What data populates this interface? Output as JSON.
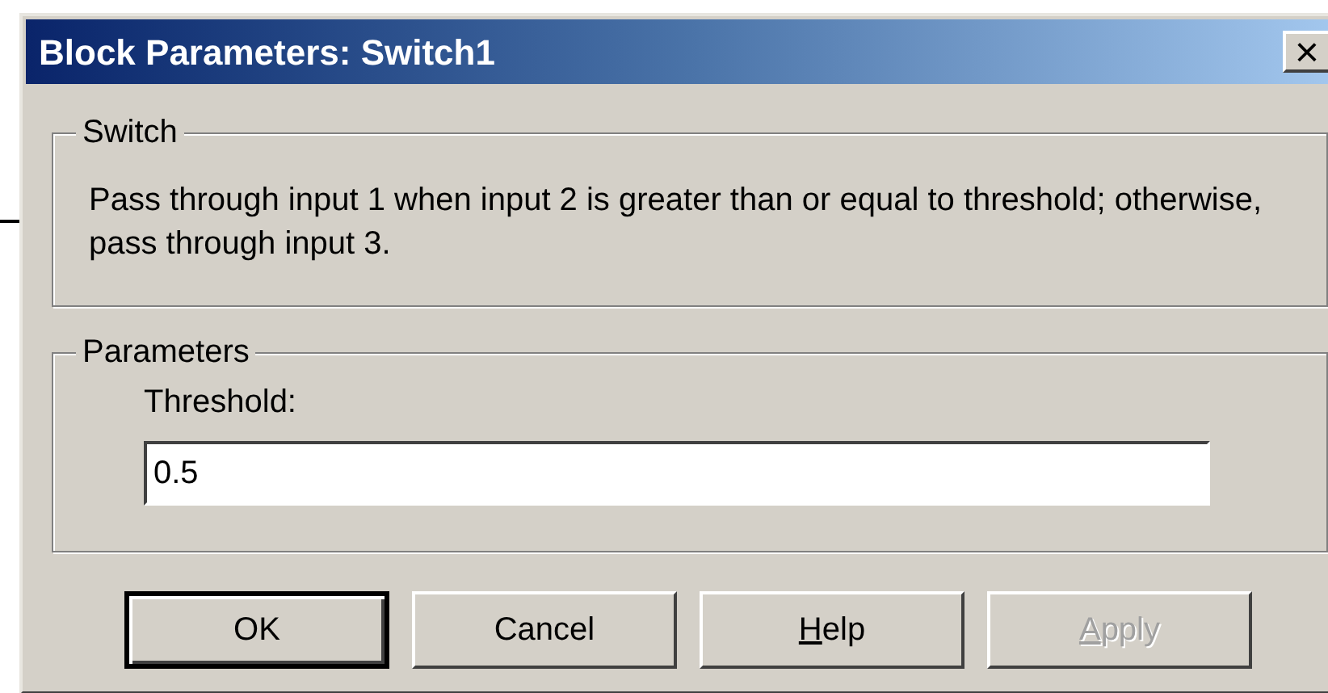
{
  "window": {
    "title": "Block Parameters: Switch1",
    "close": "×"
  },
  "description_group": {
    "title": "Switch",
    "text": "Pass through input 1 when input 2 is greater than or equal to threshold; otherwise, pass through input 3."
  },
  "parameters_group": {
    "title": "Parameters",
    "fields": [
      {
        "label": "Threshold:",
        "value": "0.5"
      }
    ]
  },
  "buttons": [
    {
      "label": "OK",
      "default": true,
      "mnemonic": false,
      "disabled": false
    },
    {
      "label": "Cancel",
      "default": false,
      "mnemonic": false,
      "disabled": false
    },
    {
      "label": "Help",
      "default": false,
      "mnemonic": true,
      "disabled": false
    },
    {
      "label": "Apply",
      "default": false,
      "mnemonic": true,
      "disabled": true
    }
  ]
}
